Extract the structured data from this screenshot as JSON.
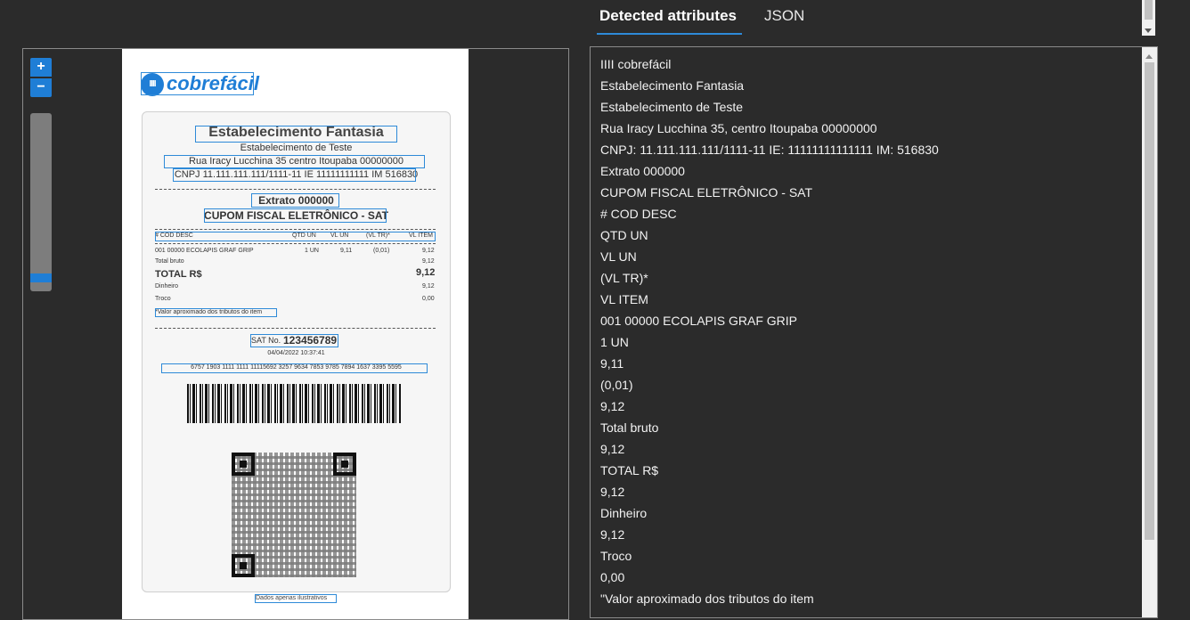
{
  "tabs": {
    "detected": "Detected attributes",
    "json": "JSON"
  },
  "viewer": {
    "zoom_in": "+",
    "zoom_out": "−",
    "logo_mark": "IIII",
    "logo_text": "cobrefácil",
    "receipt": {
      "title": "Estabelecimento Fantasia",
      "subtitle": "Estabelecimento de Teste",
      "address": "Rua Iracy Lucchina 35 centro Itoupaba 00000000",
      "ids": "CNPJ 11.111.111.111/1111-11 IE 11111111111 IM 516830",
      "extract": "Extrato 000000",
      "cupom": "CUPOM FISCAL ELETRÔNICO - SAT",
      "header_cols": [
        "# COD DESC",
        "QTD UN",
        "VL UN",
        "(VL TR)*",
        "VL ITEM"
      ],
      "item_line": "001 00000 ECOLAPIS GRAF GRIP",
      "item_qty": "1 UN",
      "item_vlun": "9,11",
      "item_vltr": "(0,01)",
      "item_total": "9,12",
      "total_bruto_label": "Total bruto",
      "total_bruto_value": "9,12",
      "total_label": "TOTAL R$",
      "total_value": "9,12",
      "dinheiro_label": "Dinheiro",
      "dinheiro_value": "9,12",
      "troco_label": "Troco",
      "troco_value": "0,00",
      "note": "*Valor aproximado dos tributos do item",
      "sat_label": "SAT No.",
      "sat_number": "123456789",
      "datetime": "04/04/2022 10:37:41",
      "access_key": "6757 1903 1111 1111 11115692 3257 9634 7853 9785 7894 1637 3395 5595",
      "disclaimer": "Dados apenas ilustrativos"
    }
  },
  "attributes": [
    "IIII cobrefácil",
    "Estabelecimento Fantasia",
    "Estabelecimento de Teste",
    "Rua Iracy Lucchina 35, centro Itoupaba 00000000",
    "CNPJ: 11.111.111.111/1111-11 IE: 11111111111111 IM: 516830",
    "Extrato 000000",
    "CUPOM FISCAL ELETRÔNICO - SAT",
    "# COD DESC",
    "QTD UN",
    "VL UN",
    "(VL TR)*",
    "VL ITEM",
    "001 00000 ECOLAPIS GRAF GRIP",
    "1 UN",
    "9,11",
    "(0,01)",
    "9,12",
    "Total bruto",
    "9,12",
    "TOTAL R$",
    "9,12",
    "Dinheiro",
    "9,12",
    "Troco",
    "0,00",
    "\"Valor aproximado dos tributos do item"
  ],
  "colors": {
    "accent": "#2e8ad8",
    "brand": "#1f7ed6",
    "background": "#2b2b2b"
  }
}
